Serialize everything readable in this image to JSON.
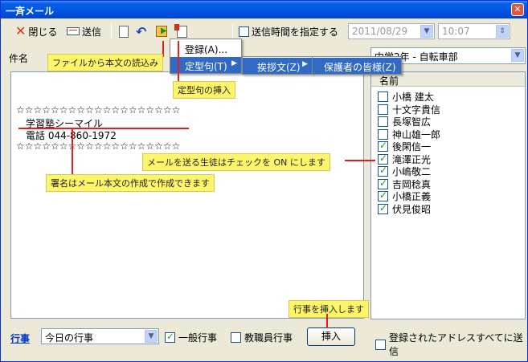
{
  "window": {
    "title": "一斉メール",
    "close_glyph": "✕"
  },
  "toolbar": {
    "close_label": "閉じる",
    "send_label": "送信",
    "schedule_label": "送信時間を指定する",
    "date_value": "2011/08/29",
    "time_value": "10:07"
  },
  "subject": {
    "label": "件名",
    "value": ""
  },
  "body": {
    "lines": [
      "☆☆☆☆☆☆☆☆☆☆☆☆☆☆☆☆☆☆☆",
      "学習塾シーマイル",
      "電話 044-860-1972",
      "☆☆☆☆☆☆☆☆☆☆☆☆☆☆☆☆☆☆☆"
    ]
  },
  "menu": {
    "items": [
      "登録(A)...",
      "定型句(T)"
    ],
    "sub_items": [
      "挨拶文(Z)"
    ],
    "sub_sub_items": [
      "保護者の皆様(Z)"
    ]
  },
  "class_select": {
    "value": "中学2年 - 自転車部"
  },
  "students": {
    "header": "名前",
    "rows": [
      {
        "name": "小橋 建太",
        "checked": false
      },
      {
        "name": "十文字貴信",
        "checked": false
      },
      {
        "name": "長塚智広",
        "checked": false
      },
      {
        "name": "神山雄一郎",
        "checked": false
      },
      {
        "name": "後閑信一",
        "checked": true
      },
      {
        "name": "滝澤正光",
        "checked": true
      },
      {
        "name": "小嶋敬二",
        "checked": true
      },
      {
        "name": "吉岡稔真",
        "checked": true
      },
      {
        "name": "小橋正義",
        "checked": true
      },
      {
        "name": "伏見俊昭",
        "checked": true
      }
    ]
  },
  "bottom": {
    "event_link": "行事",
    "event_select": "今日の行事",
    "general_event_label": "一般行事",
    "staff_event_label": "教職員行事",
    "insert_label": "挿入",
    "send_all_label": "登録されたアドレスすべてに送信"
  },
  "callouts": {
    "import_file": "ファイルから本文の読込み",
    "insert_phrase": "定型句の挿入",
    "check_students": "メールを送る生徒はチェックを ON にします",
    "signature": "署名はメール本文の作成で作成できます",
    "insert_event": "行事を挿入します"
  },
  "colors": {
    "titlebar": "#0054e3",
    "highlight": "#316ac5",
    "callout": "#fff56a",
    "arrow": "#e02020"
  }
}
